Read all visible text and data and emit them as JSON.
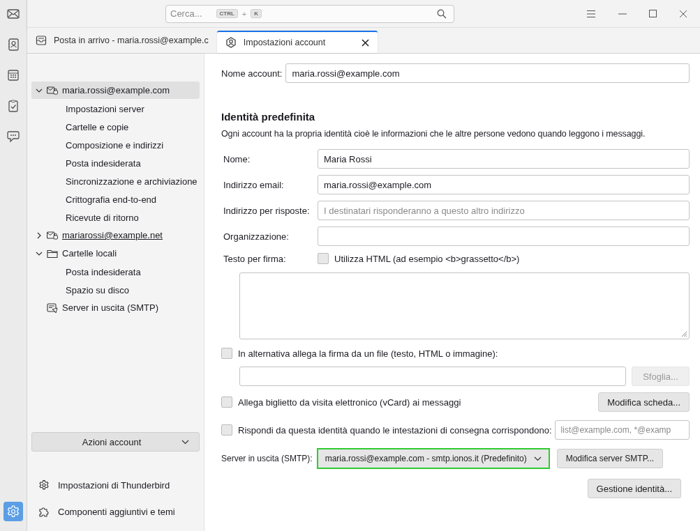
{
  "search": {
    "placeholder": "Cerca...",
    "shortcut_keys": [
      "CTRL",
      "K"
    ],
    "key_separator": "+"
  },
  "spaces": [
    {
      "kind": "mail",
      "selected": false
    },
    {
      "kind": "addressbook",
      "selected": false
    },
    {
      "kind": "calendar",
      "selected": false
    },
    {
      "kind": "tasks",
      "selected": false
    },
    {
      "kind": "chat",
      "selected": false
    }
  ],
  "settings_space": {
    "selected": true
  },
  "tabs": [
    {
      "label": "Posta in arrivo - maria.rossi@example.c",
      "kind": "inbox",
      "selected": false
    },
    {
      "label": "Impostazioni account",
      "kind": "account",
      "selected": true
    }
  ],
  "tree": [
    {
      "label": "maria.rossi@example.com",
      "kind": "account",
      "expandable": true,
      "expanded": true,
      "selected": true,
      "underlined": false,
      "children": [
        {
          "label": "Impostazioni server"
        },
        {
          "label": "Cartelle e copie"
        },
        {
          "label": "Composizione e indirizzi"
        },
        {
          "label": "Posta indesiderata"
        },
        {
          "label": "Sincronizzazione e archiviazione"
        },
        {
          "label": "Crittografia end-to-end"
        },
        {
          "label": "Ricevute di ritorno"
        }
      ]
    },
    {
      "label": "mariarossi@example.net",
      "kind": "account",
      "expandable": true,
      "expanded": false,
      "selected": false,
      "underlined": true
    },
    {
      "label": "Cartelle locali",
      "kind": "folder",
      "expandable": true,
      "expanded": true,
      "selected": false,
      "underlined": false,
      "children": [
        {
          "label": "Posta indesiderata"
        },
        {
          "label": "Spazio su disco"
        }
      ]
    },
    {
      "label": "Server in uscita (SMTP)",
      "kind": "smtp",
      "expandable": false,
      "selected": false,
      "underlined": false
    }
  ],
  "account_actions": "Azioni account",
  "footer_links": [
    {
      "label": "Impostazioni di Thunderbird",
      "kind": "settings"
    },
    {
      "label": "Componenti aggiuntivi e temi",
      "kind": "addons"
    }
  ],
  "account_name": {
    "label": "Nome account:",
    "value": "maria.rossi@example.com"
  },
  "identity": {
    "title": "Identità predefinita",
    "description": "Ogni account ha la propria identità cioè le informazioni che le altre persone vedono quando leggono i messaggi.",
    "fields": [
      {
        "label": "Nome:",
        "value": "Maria Rossi"
      },
      {
        "label": "Indirizzo email:",
        "value": "maria.rossi@example.com"
      },
      {
        "label": "Indirizzo per risposte:",
        "placeholder": "I destinatari risponderanno a questo altro indirizzo"
      },
      {
        "label": "Organizzazione:"
      }
    ]
  },
  "signature": {
    "label": "Testo per firma:",
    "html_option": "Utilizza HTML (ad esempio <b>grassetto</b>)",
    "html_checked": false
  },
  "attach_signature": {
    "label": "In alternativa allega la firma da un file (testo, HTML o immagine):",
    "checked": false,
    "browse_button": "Sfoglia...",
    "browse_disabled": true
  },
  "vcard": {
    "label": "Allega biglietto da visita elettronico (vCard) ai messaggi",
    "checked": false,
    "button": "Modifica scheda..."
  },
  "reply_from": {
    "label": "Rispondi da questa identità quando le intestazioni di consegna corrispondono:",
    "checked": false,
    "placeholder": "list@example.com, *@examp"
  },
  "smtp": {
    "label": "Server in uscita (SMTP):",
    "value": "maria.rossi@example.com - smtp.ionos.it (Predefinito)",
    "focused": true,
    "button": "Modifica server SMTP..."
  },
  "identities_button": "Gestione identità..."
}
